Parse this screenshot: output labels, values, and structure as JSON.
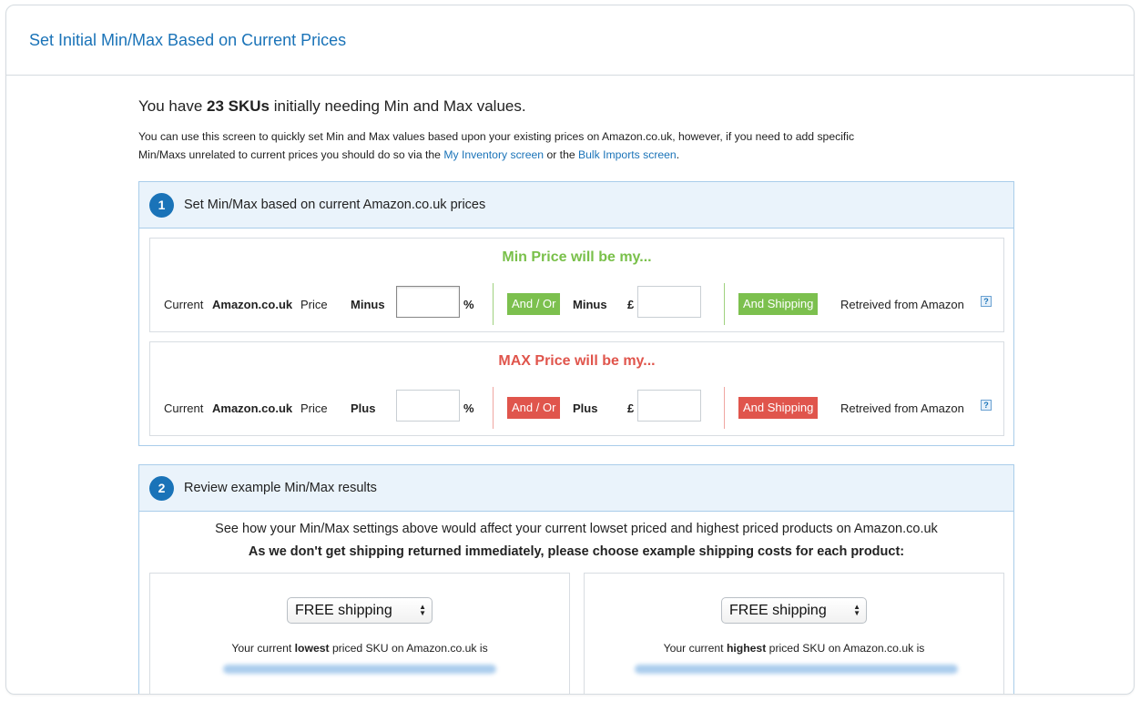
{
  "header": {
    "title": "Set Initial Min/Max Based on Current Prices"
  },
  "intro": {
    "heading_pre": "You have ",
    "heading_count": "23 SKUs",
    "heading_post": " initially needing Min and Max values.",
    "text_1": "You can use this screen to quickly set Min and Max values based upon your existing prices on Amazon.co.uk, however, if you need to add specific",
    "text_2_pre": "Min/Maxs unrelated to current prices you should do so via the ",
    "link_inventory": "My Inventory screen",
    "text_2_mid": " or the ",
    "link_bulk": "Bulk Imports screen",
    "text_2_post": "."
  },
  "step1": {
    "number": "1",
    "title": "Set Min/Max based on current Amazon.co.uk prices",
    "min": {
      "title": "Min Price will be my...",
      "current": "Current",
      "marketplace": "Amazon.co.uk",
      "price": "Price",
      "operator": "Minus",
      "percent_value": "",
      "percent_sign": "%",
      "and_or": "And / Or",
      "operator2": "Minus",
      "currency": "£",
      "amount_value": "",
      "and_shipping": "And Shipping",
      "retrieved": "Retreived from Amazon",
      "help": "?"
    },
    "max": {
      "title": "MAX Price will be my...",
      "current": "Current",
      "marketplace": "Amazon.co.uk",
      "price": "Price",
      "operator": "Plus",
      "percent_value": "",
      "percent_sign": "%",
      "and_or": "And / Or",
      "operator2": "Plus",
      "currency": "£",
      "amount_value": "",
      "and_shipping": "And Shipping",
      "retrieved": "Retreived from Amazon",
      "help": "?"
    }
  },
  "step2": {
    "number": "2",
    "title": "Review example Min/Max results",
    "intro": "See how your Min/Max settings above would affect your current lowset priced and highest priced products on Amazon.co.uk",
    "intro_bold": "As we don't get shipping returned immediately, please choose example shipping costs for each product:",
    "lowest": {
      "shipping_selected": "FREE shipping",
      "caption_pre": "Your current ",
      "caption_bold": "lowest",
      "caption_post": " priced SKU on Amazon.co.uk is"
    },
    "highest": {
      "shipping_selected": "FREE shipping",
      "caption_pre": "Your current ",
      "caption_bold": "highest",
      "caption_post": " priced SKU on Amazon.co.uk is"
    }
  },
  "colors": {
    "accent_blue": "#1a73b8",
    "min_green": "#7cc04e",
    "max_red": "#e0554c",
    "panel_bg": "#eaf3fb",
    "panel_border": "#a9cdea"
  }
}
